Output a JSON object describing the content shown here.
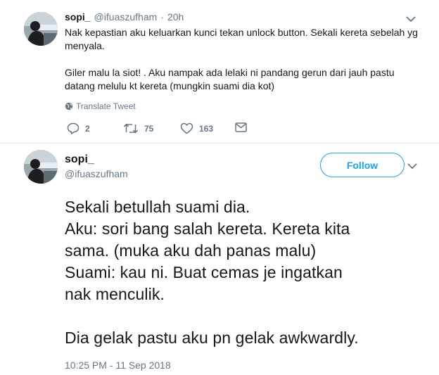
{
  "tweet1": {
    "name": "sopi_",
    "handle": "@ifuaszufham",
    "separator": "·",
    "time": "20h",
    "lines": [
      "Nak kepastian aku keluarkan kunci tekan unlock button. Sekali kereta sebelah yg",
      "menyala.",
      "",
      "Giler malu la siot! . Aku nampak ada lelaki ni pandang gerun dari jauh pastu",
      "datang melulu kt kereta (mungkin suami dia kot)"
    ],
    "translate_label": "Translate Tweet",
    "actions": {
      "reply_icon": "reply-icon",
      "reply_count": "2",
      "retweet_icon": "retweet-icon",
      "retweet_count": "75",
      "like_icon": "heart-icon",
      "like_count": "163",
      "dm_icon": "envelope-icon"
    }
  },
  "tweet2": {
    "name": "sopi_",
    "handle": "@ifuaszufham",
    "follow_label": "Follow",
    "lines": [
      "Sekali betullah suami dia.",
      "Aku: sori bang salah kereta. Kereta kita",
      "sama. (muka aku dah panas malu)",
      "Suami: kau ni. Buat cemas je ingatkan",
      "nak menculik.",
      "",
      "Dia gelak pastu aku pn gelak awkwardly."
    ],
    "timestamp": "10:25 PM - 11 Sep 2018"
  },
  "colors": {
    "accent": "#1da1f2",
    "secondary_text": "#657786",
    "primary_text": "#14171a",
    "divider": "#e6ecf0"
  }
}
